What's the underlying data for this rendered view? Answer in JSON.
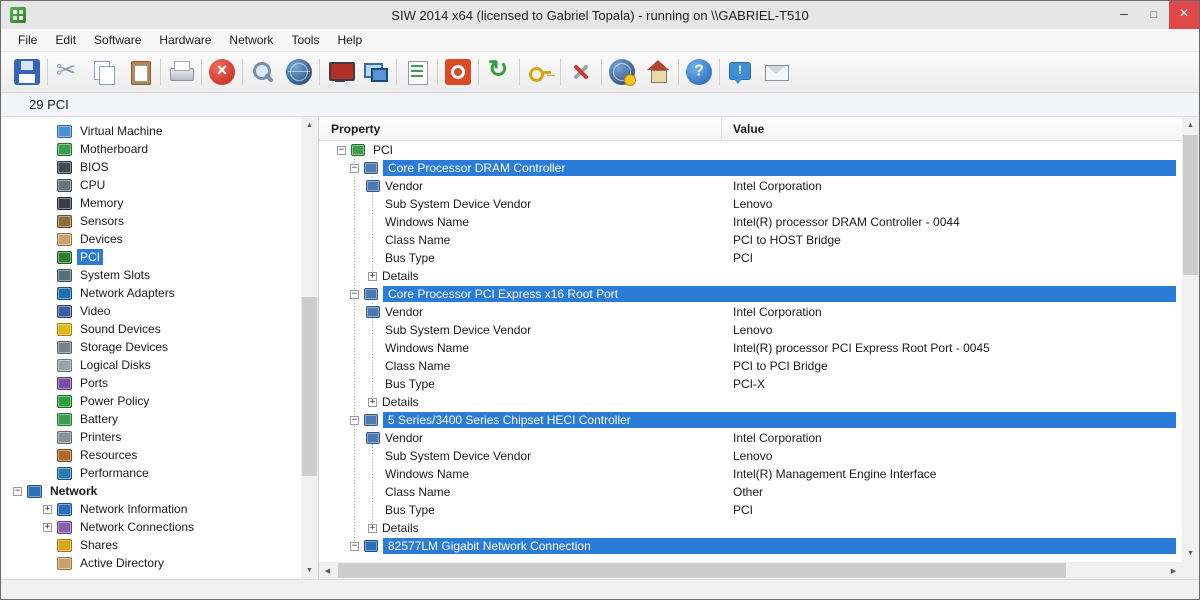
{
  "icons": {
    "minus": "−",
    "plus": "+",
    "up": "▲",
    "down": "▼",
    "left": "◀",
    "right": "▶"
  },
  "colors": {
    "selection": "#2b7bd9",
    "close_button": "#e04848"
  },
  "window": {
    "title": "SIW 2014 x64 (licensed to Gabriel Topala) - running on \\\\GABRIEL-T510",
    "controls": [
      {
        "name": "minimize",
        "glyph": "–"
      },
      {
        "name": "maximize",
        "glyph": "□"
      },
      {
        "name": "close",
        "glyph": "×"
      }
    ]
  },
  "menu": {
    "items": [
      "File",
      "Edit",
      "Software",
      "Hardware",
      "Network",
      "Tools",
      "Help"
    ]
  },
  "toolbar": {
    "groups": [
      [
        "save"
      ],
      [
        "cut",
        "copy",
        "paste"
      ],
      [
        "print"
      ],
      [
        "stop"
      ],
      [
        "search",
        "web"
      ],
      [
        "monitor",
        "remote-desktop"
      ],
      [
        "report"
      ],
      [
        "license"
      ],
      [
        "refresh"
      ],
      [
        "password"
      ],
      [
        "tools"
      ],
      [
        "web-update",
        "home"
      ],
      [
        "help"
      ],
      [
        "feedback",
        "email"
      ]
    ]
  },
  "infobar": {
    "label": "29 PCI"
  },
  "sidebar": {
    "icon_colors": {
      "virtual-machine": "#4a90d9",
      "motherboard": "#3f9e4d",
      "bios": "#444a52",
      "cpu": "#6b7280",
      "memory": "#3a3f46",
      "sensors": "#8e6b3a",
      "devices": "#c9a36b",
      "pci": "#2e7d32",
      "system-slots": "#546e7a",
      "network-adapters": "#1f6fb2",
      "video": "#3b5fa0",
      "sound-devices": "#e0b818",
      "storage-devices": "#7a8288",
      "logical-disks": "#9aa2a8",
      "ports": "#7a4fa0",
      "power-policy": "#2f9e3f",
      "battery": "#3f9e4d",
      "printers": "#8a9099",
      "resources": "#b06a2a",
      "performance": "#2a7ab0",
      "network": "#2a6fb8",
      "network-information": "#2a6fb8",
      "network-connections": "#8a5fb0",
      "shares": "#d9a514",
      "active-directory": "#c9a36b"
    },
    "items": [
      {
        "label": "Virtual Machine",
        "icon": "virtual-machine",
        "level": 2
      },
      {
        "label": "Motherboard",
        "icon": "motherboard",
        "level": 2
      },
      {
        "label": "BIOS",
        "icon": "bios",
        "level": 2
      },
      {
        "label": "CPU",
        "icon": "cpu",
        "level": 2
      },
      {
        "label": "Memory",
        "icon": "memory",
        "level": 2
      },
      {
        "label": "Sensors",
        "icon": "sensors",
        "level": 2
      },
      {
        "label": "Devices",
        "icon": "devices",
        "level": 2
      },
      {
        "label": "PCI",
        "icon": "pci",
        "level": 2,
        "selected": true
      },
      {
        "label": "System Slots",
        "icon": "system-slots",
        "level": 2
      },
      {
        "label": "Network Adapters",
        "icon": "network-adapters",
        "level": 2
      },
      {
        "label": "Video",
        "icon": "video",
        "level": 2
      },
      {
        "label": "Sound Devices",
        "icon": "sound-devices",
        "level": 2
      },
      {
        "label": "Storage Devices",
        "icon": "storage-devices",
        "level": 2
      },
      {
        "label": "Logical Disks",
        "icon": "logical-disks",
        "level": 2
      },
      {
        "label": "Ports",
        "icon": "ports",
        "level": 2
      },
      {
        "label": "Power Policy",
        "icon": "power-policy",
        "level": 2
      },
      {
        "label": "Battery",
        "icon": "battery",
        "level": 2
      },
      {
        "label": "Printers",
        "icon": "printers",
        "level": 2
      },
      {
        "label": "Resources",
        "icon": "resources",
        "level": 2
      },
      {
        "label": "Performance",
        "icon": "performance",
        "level": 2
      },
      {
        "label": "Network",
        "icon": "network",
        "level": 1,
        "bold": true,
        "expander": "minus"
      },
      {
        "label": "Network Information",
        "icon": "network-information",
        "level": 2,
        "expander": "plus"
      },
      {
        "label": "Network Connections",
        "icon": "network-connections",
        "level": 2,
        "expander": "plus"
      },
      {
        "label": "Shares",
        "icon": "shares",
        "level": 2
      },
      {
        "label": "Active Directory",
        "icon": "active-directory",
        "level": 2
      }
    ]
  },
  "main": {
    "columns": [
      "Property",
      "Value"
    ],
    "root_label": "PCI",
    "icon_colors": {
      "pci-root": "#3f9e4d",
      "pci-device": "#4a7ab5",
      "vendor": "#4a7ab5",
      "network-device": "#2a6fb8"
    },
    "groups": [
      {
        "name": "Core Processor DRAM Controller",
        "icon": "pci-device",
        "rows": [
          {
            "property": "Vendor",
            "value": "Intel Corporation",
            "icon": "vendor"
          },
          {
            "property": "Sub System Device Vendor",
            "value": "Lenovo"
          },
          {
            "property": "Windows Name",
            "value": "Intel(R) processor DRAM Controller - 0044"
          },
          {
            "property": "Class Name",
            "value": "PCI to HOST Bridge"
          },
          {
            "property": "Bus Type",
            "value": "PCI"
          }
        ],
        "details_label": "Details"
      },
      {
        "name": "Core Processor PCI Express x16 Root Port",
        "icon": "pci-device",
        "rows": [
          {
            "property": "Vendor",
            "value": "Intel Corporation",
            "icon": "vendor"
          },
          {
            "property": "Sub System Device Vendor",
            "value": "Lenovo"
          },
          {
            "property": "Windows Name",
            "value": "Intel(R) processor PCI Express Root Port - 0045"
          },
          {
            "property": "Class Name",
            "value": "PCI to PCI Bridge"
          },
          {
            "property": "Bus Type",
            "value": "PCI-X"
          }
        ],
        "details_label": "Details"
      },
      {
        "name": "5 Series/3400 Series Chipset HECI Controller",
        "icon": "pci-device",
        "rows": [
          {
            "property": "Vendor",
            "value": "Intel Corporation",
            "icon": "vendor"
          },
          {
            "property": "Sub System Device Vendor",
            "value": "Lenovo"
          },
          {
            "property": "Windows Name",
            "value": "Intel(R) Management Engine Interface"
          },
          {
            "property": "Class Name",
            "value": "Other"
          },
          {
            "property": "Bus Type",
            "value": "PCI"
          }
        ],
        "details_label": "Details"
      },
      {
        "name": "82577LM Gigabit Network Connection",
        "icon": "network-device",
        "rows": []
      }
    ]
  }
}
